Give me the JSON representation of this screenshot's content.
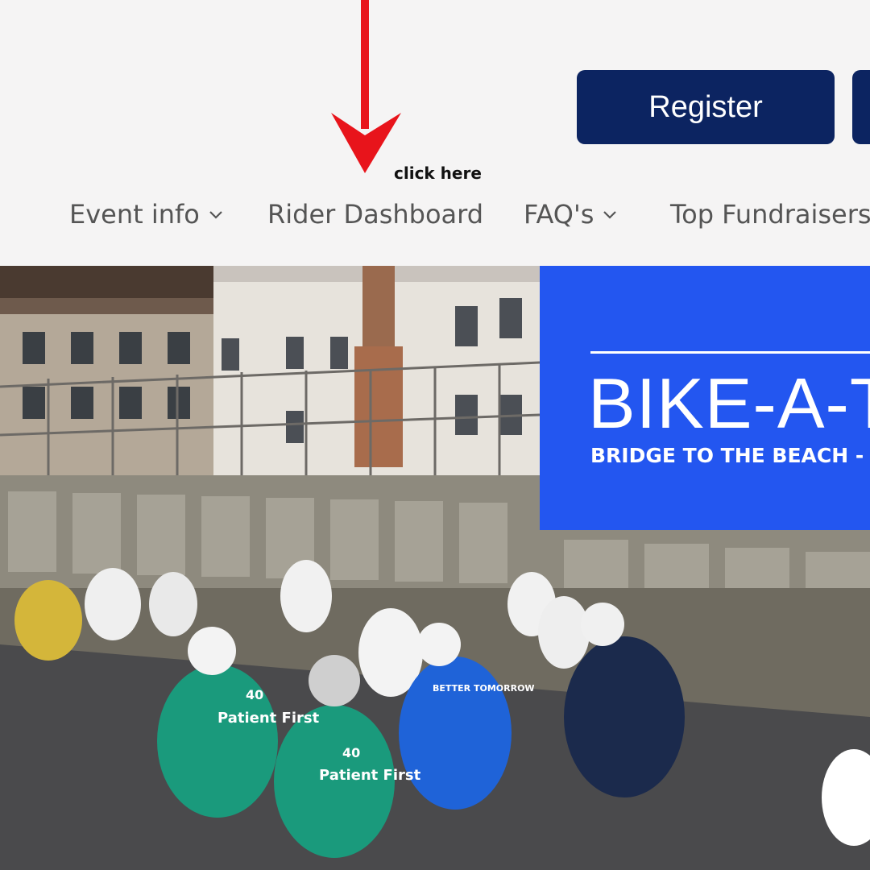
{
  "header": {
    "register_label": "Register",
    "annotation_label": "click here",
    "annotation_color": "#e8141b"
  },
  "nav": {
    "items": [
      {
        "label": "Event info",
        "has_dropdown": true
      },
      {
        "label": "Rider Dashboard",
        "has_dropdown": false
      },
      {
        "label": "FAQ's",
        "has_dropdown": true
      },
      {
        "label": "Top Fundraisers",
        "has_dropdown": false
      }
    ]
  },
  "hero": {
    "title": "BIKE-A-T",
    "subtitle": "BRIDGE TO THE BEACH -",
    "jerseys": [
      {
        "text": "Patient First",
        "number": "40"
      },
      {
        "text": "Patient First",
        "number": "40"
      },
      {
        "text": "BETTER TOMORROW"
      }
    ]
  },
  "colors": {
    "brand_navy": "#0c2461",
    "promo_blue": "#2356f0",
    "nav_text": "#555555",
    "background": "#f5f4f4"
  },
  "icons": {
    "dropdown": "chevron-down-icon",
    "annotation": "red-arrow-down-icon"
  }
}
